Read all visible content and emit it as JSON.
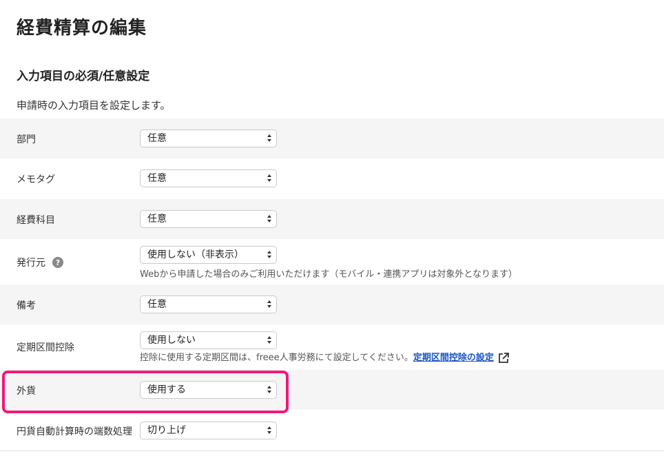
{
  "page": {
    "title": "経費精算の編集",
    "section_title": "入力項目の必須/任意設定",
    "section_description": "申請時の入力項目を設定します。"
  },
  "rows": [
    {
      "label": "部門",
      "value": "任意"
    },
    {
      "label": "メモタグ",
      "value": "任意"
    },
    {
      "label": "経費科目",
      "value": "任意"
    },
    {
      "label": "発行元",
      "value": "使用しない（非表示）",
      "help": "?",
      "note": "Webから申請した場合のみご利用いただけます（モバイル・連携アプリは対象外となります）"
    },
    {
      "label": "備考",
      "value": "任意"
    },
    {
      "label": "定期区間控除",
      "value": "使用しない",
      "note": "控除に使用する定期区間は、freee人事労務にて設定してください。",
      "link": "定期区間控除の設定"
    },
    {
      "label": "外貨",
      "value": "使用する"
    },
    {
      "label": "円貨自動計算時の端数処理",
      "value": "切り上げ"
    }
  ],
  "colors": {
    "highlight": "#f0197a",
    "link": "#1a55c5",
    "row_alt_bg": "#f6f5f5"
  }
}
